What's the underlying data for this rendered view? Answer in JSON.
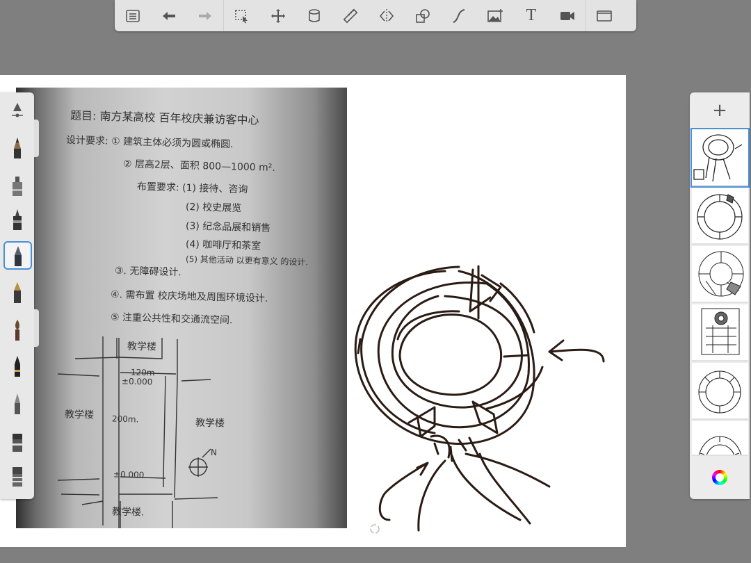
{
  "toolbar": {
    "items": [
      {
        "name": "layers-list-icon"
      },
      {
        "name": "undo-icon"
      },
      {
        "name": "redo-icon"
      },
      {
        "name": "selection-icon"
      },
      {
        "name": "transform-icon"
      },
      {
        "name": "fill-icon"
      },
      {
        "name": "ruler-icon"
      },
      {
        "name": "symmetry-icon"
      },
      {
        "name": "shape-icon"
      },
      {
        "name": "curve-icon"
      },
      {
        "name": "image-icon"
      },
      {
        "name": "text-tool-icon",
        "glyph": "T"
      },
      {
        "name": "video-icon"
      },
      {
        "name": "fullscreen-icon"
      }
    ]
  },
  "photo": {
    "lines": [
      "题目: 南方某高校 百年校庆兼访客中心",
      "设计要求: ① 建筑主体必须为圆或椭圆.",
      "② 层高2层、面积 800—1000 m².",
      "布置要求: (1) 接待、咨询",
      "(2) 校史展览",
      "(3) 纪念品展和销售",
      "(4) 咖啡厅和茶室",
      "(5) 其他活动 以更有意义 的设计.",
      "③. 无障碍设计.",
      "④. 需布置 校庆场地及周围环境设计.",
      "⑤ 注重公共性和交通流空间."
    ],
    "site": {
      "top": "教学楼",
      "left": "教学楼",
      "right": "教学楼",
      "bottom": "教学楼.",
      "width": "120m",
      "length": "200m.",
      "level_top": "±0.000",
      "level_bottom": "±0.000",
      "north": "N"
    }
  },
  "brushes": {
    "items": [
      "brush-settings",
      "pencil",
      "marker",
      "ink-pen",
      "airbrush",
      "fountain-pen",
      "paintbrush",
      "brush-pen",
      "soft-pencil",
      "eraser",
      "smudge"
    ],
    "selected_index": 3
  },
  "layers": {
    "add_label": "+",
    "count": 6,
    "selected_index": 0,
    "colors": {
      "accent": "#4a90d9",
      "ink": "#2a1b14"
    }
  }
}
